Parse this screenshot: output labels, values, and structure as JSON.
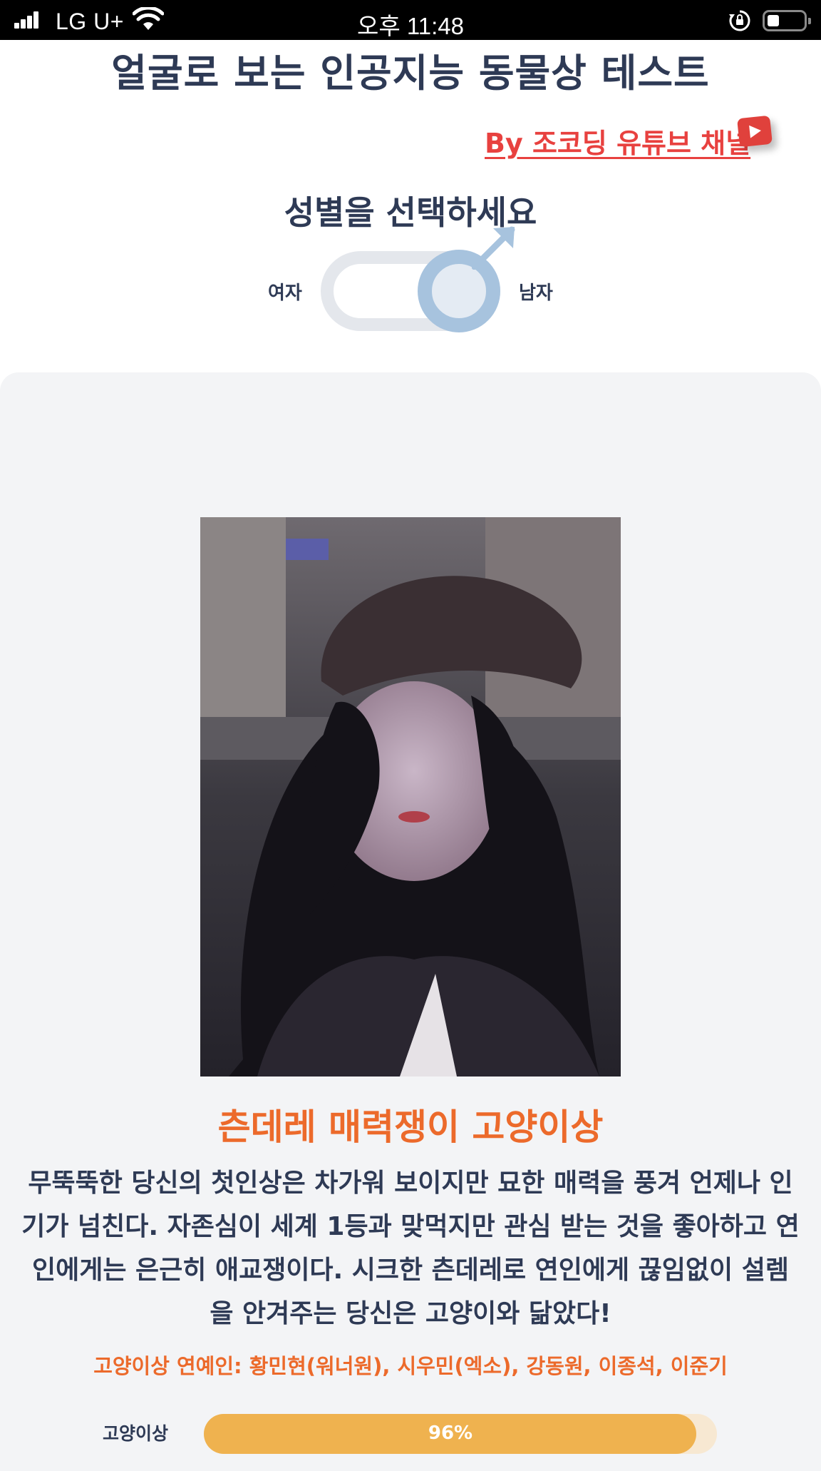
{
  "status_bar": {
    "carrier": "LG U+",
    "time": "오후 11:48",
    "icons": [
      "signal-icon",
      "wifi-icon",
      "rotation-lock-icon",
      "battery-icon"
    ]
  },
  "header": {
    "title": "얼굴로 보는 인공지능 동물상 테스트",
    "by_link": "By 조코딩 유튜브 채널",
    "link_icon": "youtube-icon"
  },
  "gender": {
    "heading": "성별을 선택하세요",
    "female_label": "여자",
    "male_label": "남자",
    "selected": "남자"
  },
  "result": {
    "title": "츤데레 매력쟁이 고양이상",
    "description": "무뚝뚝한 당신의 첫인상은 차가워 보이지만 묘한 매력을 풍겨 언제나 인기가 넘친다. 자존심이 세계 1등과 맞먹지만 관심 받는 것을 좋아하고 연인에게는 은근히 애교쟁이다. 시크한 츤데레로 연인에게 끊임없이 설렘을 안겨주는 당신은 고양이와 닮았다!",
    "celebrities": "고양이상 연예인: 황민현(워너원), 시우민(엑소), 강동원, 이종석, 이준기",
    "bar_label": "고양이상",
    "percent": 96,
    "percent_text": "96%"
  },
  "colors": {
    "title": "#2e3a55",
    "link": "#e8413f",
    "accent": "#ec6a2b",
    "bar_fill": "#efb24f",
    "bar_track": "#f7e8d2",
    "toggle_knob": "#a7c3de"
  }
}
